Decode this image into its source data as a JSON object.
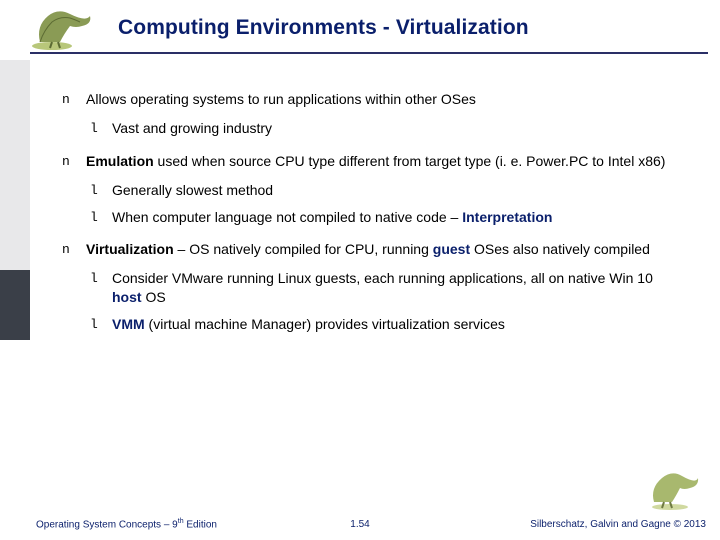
{
  "header": {
    "title": "Computing Environments - Virtualization"
  },
  "bullets": {
    "b1": "Allows operating systems to run applications within other OSes",
    "b1s1": "Vast and growing industry",
    "b2_emph": "Emulation",
    "b2_rest": " used when source CPU type different from target type (i. e. Power.PC to Intel x86)",
    "b2s1": "Generally slowest method",
    "b2s2a": "When computer language not compiled to native code – ",
    "b2s2b": "Interpretation",
    "b3_emph": "Virtualization",
    "b3_mid": " – OS natively compiled for CPU, running ",
    "b3_guest": "guest",
    "b3_rest": " OSes  also natively compiled",
    "b3s1a": "Consider VMware running Linux guests, each running applications, all on native Win 10 ",
    "b3s1_host": "host",
    "b3s1b": " OS",
    "b3s2_vmm": "VMM",
    "b3s2_rest": " (virtual machine Manager) provides virtualization services"
  },
  "footer": {
    "left_a": "Operating System Concepts – 9",
    "left_sup": "th",
    "left_b": " Edition",
    "center": "1.54",
    "right": "Silberschatz, Galvin and Gagne © 2013"
  },
  "colors": {
    "accent": "#0a1f6b"
  }
}
